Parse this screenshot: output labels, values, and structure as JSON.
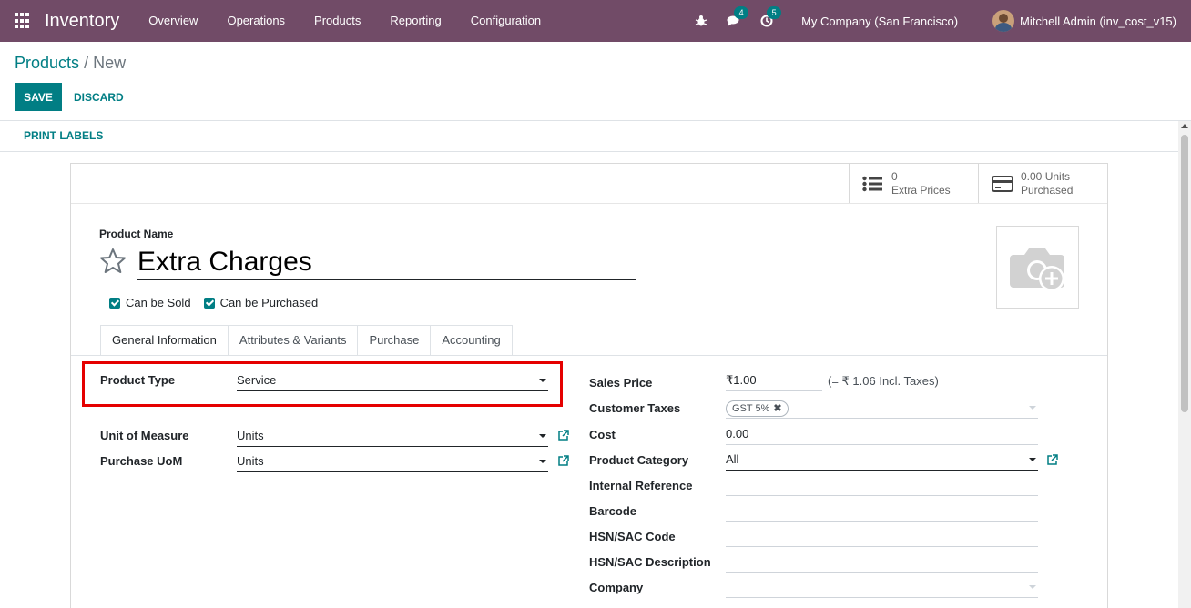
{
  "navbar": {
    "app_title": "Inventory",
    "menu": [
      "Overview",
      "Operations",
      "Products",
      "Reporting",
      "Configuration"
    ],
    "messages_count": "4",
    "activities_count": "5",
    "company": "My Company (San Francisco)",
    "user": "Mitchell Admin (inv_cost_v15)",
    "bar_color": "#714B67"
  },
  "control_panel": {
    "breadcrumb_parent": "Products",
    "breadcrumb_sep": "/",
    "breadcrumb_current": "New",
    "save_label": "SAVE",
    "discard_label": "DISCARD",
    "print_labels": "PRINT LABELS",
    "accent_color": "#017e84"
  },
  "smart_buttons": {
    "extra_prices_count": "0",
    "extra_prices_label": "Extra Prices",
    "purchased_value": "0.00 Units",
    "purchased_label": "Purchased"
  },
  "product": {
    "name_label": "Product Name",
    "name_value": "Extra Charges",
    "can_be_sold_label": "Can be Sold",
    "can_be_purchased_label": "Can be Purchased",
    "can_be_sold": true,
    "can_be_purchased": true
  },
  "tabs": [
    "General Information",
    "Attributes & Variants",
    "Purchase",
    "Accounting"
  ],
  "left_fields": {
    "product_type_label": "Product Type",
    "product_type_value": "Service",
    "uom_label": "Unit of Measure",
    "uom_value": "Units",
    "purchase_uom_label": "Purchase UoM",
    "purchase_uom_value": "Units"
  },
  "right_fields": {
    "sales_price_label": "Sales Price",
    "sales_price_value": "₹1.00",
    "incl_taxes": "(= ₹ 1.06 Incl. Taxes)",
    "customer_taxes_label": "Customer Taxes",
    "customer_taxes_tag": "GST 5%",
    "cost_label": "Cost",
    "cost_value": "0.00",
    "category_label": "Product Category",
    "category_value": "All",
    "internal_ref_label": "Internal Reference",
    "barcode_label": "Barcode",
    "hsn_code_label": "HSN/SAC Code",
    "hsn_desc_label": "HSN/SAC Description",
    "company_label": "Company"
  }
}
